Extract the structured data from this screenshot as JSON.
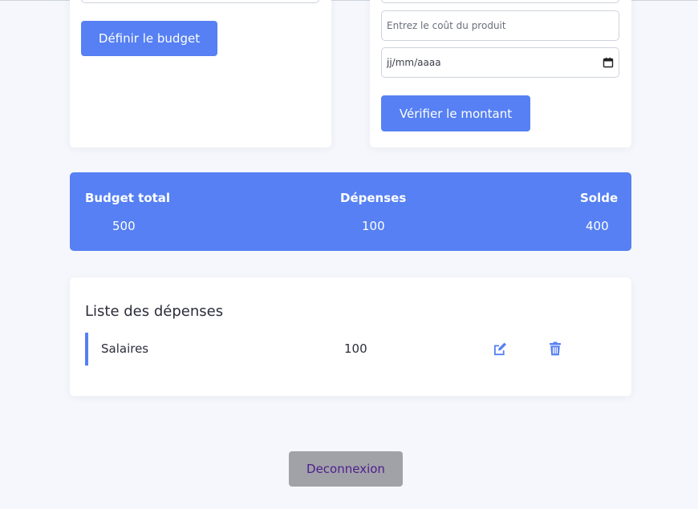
{
  "budget_form": {
    "submit_label": "Définir le budget"
  },
  "expense_form": {
    "cost_placeholder": "Entrez le coût du produit",
    "date_placeholder": "jj/mm/aaaa",
    "submit_label": "Vérifier le montant"
  },
  "summary": {
    "total_label": "Budget total",
    "total_value": "500",
    "expenses_label": "Dépenses",
    "expenses_value": "100",
    "balance_label": "Solde",
    "balance_value": "400"
  },
  "expense_list": {
    "title": "Liste des dépenses",
    "items": [
      {
        "name": "Salaires",
        "amount": "100"
      }
    ]
  },
  "logout_label": "Deconnexion",
  "icons": {
    "edit": "edit-icon",
    "delete": "trash-icon",
    "calendar": "calendar-icon"
  },
  "colors": {
    "accent": "#5680f3",
    "logout_bg": "#a1a2a8",
    "logout_text": "#4d1e8c"
  }
}
